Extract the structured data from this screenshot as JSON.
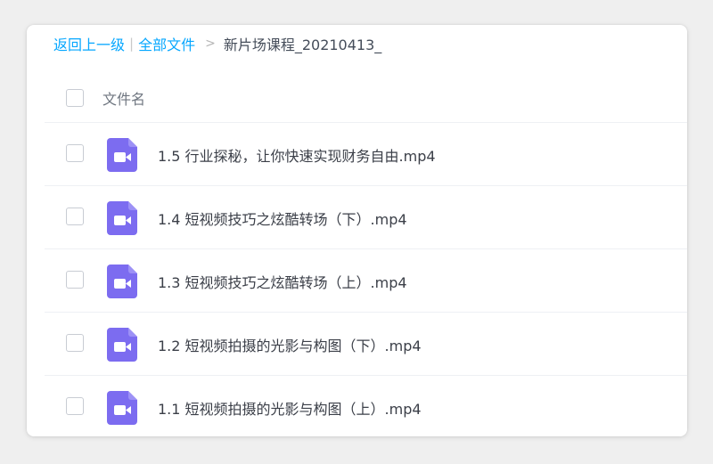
{
  "breadcrumb": {
    "back_label": "返回上一级",
    "divider": "|",
    "all_files_label": "全部文件",
    "arrow": ">",
    "current_folder": "新片场课程_20210413_"
  },
  "list": {
    "header_label": "文件名",
    "files": [
      {
        "name": "1.5 行业探秘，让你快速实现财务自由.mp4",
        "icon": "video-file-icon"
      },
      {
        "name": "1.4 短视频技巧之炫酷转场（下）.mp4",
        "icon": "video-file-icon"
      },
      {
        "name": "1.3 短视频技巧之炫酷转场（上）.mp4",
        "icon": "video-file-icon"
      },
      {
        "name": "1.2 短视频拍摄的光影与构图（下）.mp4",
        "icon": "video-file-icon"
      },
      {
        "name": "1.1 短视频拍摄的光影与构图（上）.mp4",
        "icon": "video-file-icon"
      }
    ]
  },
  "colors": {
    "link": "#06a7ff",
    "video_icon": "#7c6cf0"
  }
}
